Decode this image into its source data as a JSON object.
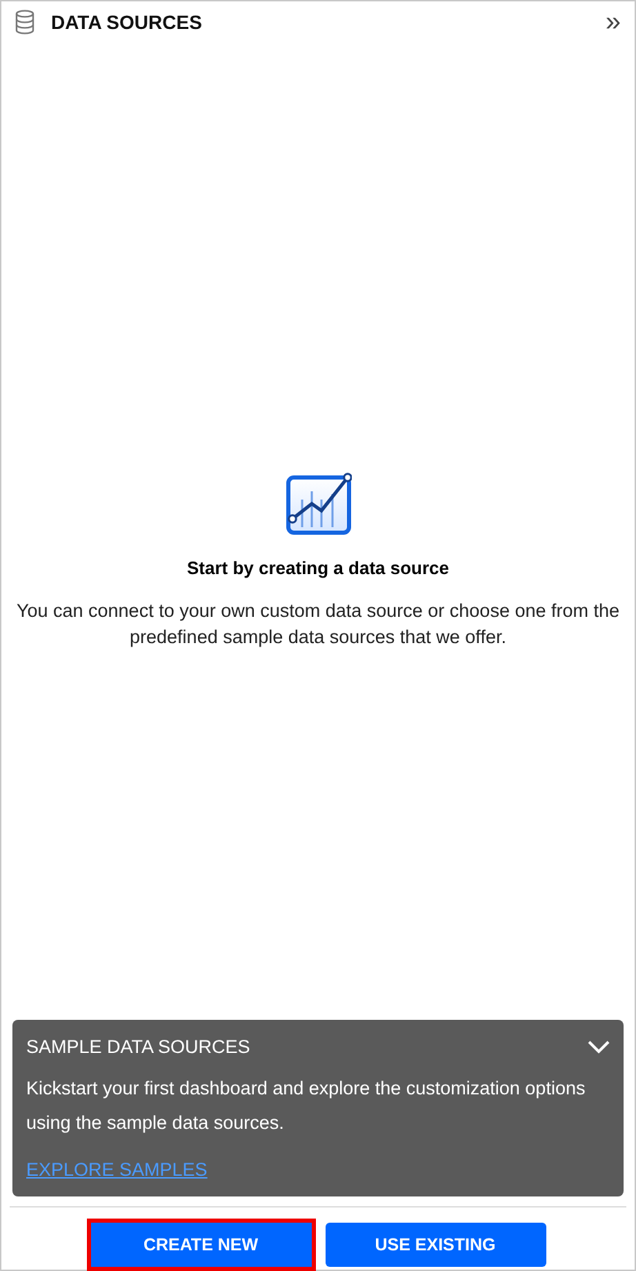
{
  "header": {
    "title": "DATA SOURCES",
    "collapse_glyph": "»"
  },
  "empty_state": {
    "title": "Start by creating a data source",
    "description": "You can connect to your own custom data source or choose one from the predefined sample data sources that we offer."
  },
  "sample_panel": {
    "title": "SAMPLE DATA SOURCES",
    "expanded": true,
    "description": "Kickstart your first dashboard and explore the customization options using the sample data sources.",
    "link": "EXPLORE SAMPLES"
  },
  "buttons": [
    {
      "label": "CREATE NEW",
      "highlighted": true
    },
    {
      "label": "USE EXISTING",
      "highlighted": false
    }
  ]
}
